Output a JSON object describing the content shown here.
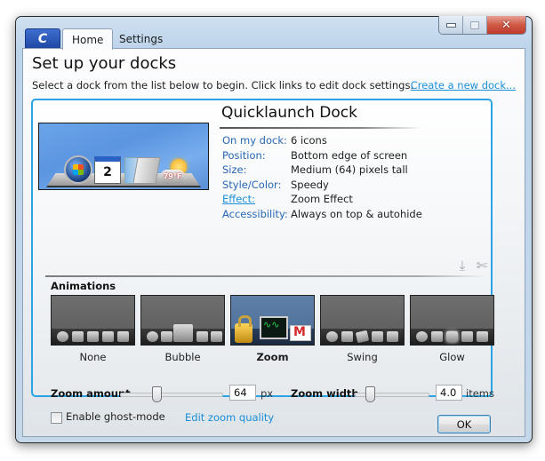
{
  "window": {
    "controls": {
      "minimize": "minimize",
      "maximize": "maximize",
      "close": "✕"
    }
  },
  "app_icon_glyph": "C",
  "tabs": [
    {
      "label": "Home",
      "active": true
    },
    {
      "label": "Settings",
      "active": false
    }
  ],
  "page": {
    "title": "Set up your docks",
    "subtitle": "Select a dock from the list below to begin. Click links to edit dock settings.",
    "create_link": "Create a new dock..."
  },
  "dock": {
    "name": "Quicklaunch Dock",
    "preview_calendar_day": "2",
    "preview_weather": "79°F",
    "properties": [
      {
        "key": "On my dock:",
        "value": "6 icons",
        "link": false
      },
      {
        "key": "Position:",
        "value": "Bottom edge of screen",
        "link": false
      },
      {
        "key": "Size:",
        "value": "Medium (64) pixels tall",
        "link": false
      },
      {
        "key": "Style/Color:",
        "value": "Speedy",
        "link": false
      },
      {
        "key": "Effect:",
        "value": "Zoom Effect",
        "link": true
      },
      {
        "key": "Accessibility:",
        "value": "Always on top & autohide",
        "link": false
      }
    ],
    "actions": {
      "export_glyph": "⤓",
      "delete_glyph": "✄"
    }
  },
  "animations": {
    "heading": "Animations",
    "options": [
      {
        "label": "None",
        "selected": false
      },
      {
        "label": "Bubble",
        "selected": false
      },
      {
        "label": "Zoom",
        "selected": true
      },
      {
        "label": "Swing",
        "selected": false
      },
      {
        "label": "Glow",
        "selected": false
      }
    ]
  },
  "zoom_amount": {
    "label": "Zoom amount",
    "value": "64",
    "unit": "px",
    "slider_fraction": 0.33
  },
  "zoom_width": {
    "label": "Zoom width",
    "value": "4.0",
    "unit": "items",
    "slider_fraction": 0.15
  },
  "ghost_mode": {
    "label": "Enable ghost-mode",
    "checked": false
  },
  "quality_link": "Edit zoom quality",
  "ok_label": "OK"
}
